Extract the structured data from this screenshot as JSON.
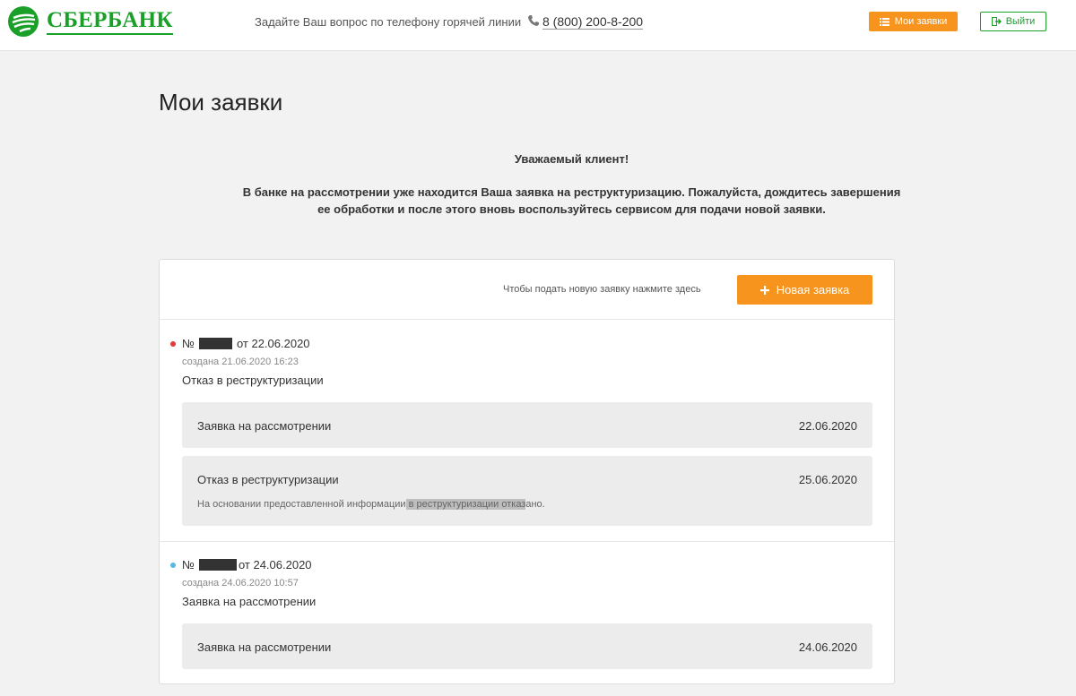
{
  "header": {
    "logo_text": "СБЕРБАНК",
    "hotline_text": "Задайте Ваш вопрос по телефону горячей линии",
    "phone": "8 (800) 200-8-200",
    "my_requests_label": "Мои заявки",
    "logout_label": "Выйти"
  },
  "page": {
    "title": "Мои заявки",
    "notice_heading": "Уважаемый клиент!",
    "notice_line1": "В банке на рассмотрении уже находится Ваша заявка на реструктуризацию. Пожалуйста, дождитесь завершения",
    "notice_line2": "ее обработки и после этого вновь воспользуйтесь сервисом для подачи новой заявки."
  },
  "card": {
    "new_hint": "Чтобы подать новую заявку нажмите здесь",
    "new_button": "Новая заявка"
  },
  "applications": [
    {
      "number_prefix": "№",
      "date_text": "от 22.06.2020",
      "created": "создана 21.06.2020 16:23",
      "status": "Отказ в реструктуризации",
      "dot_color": "#e53935",
      "stages": [
        {
          "name": "Заявка на рассмотрении",
          "date": "22.06.2020"
        },
        {
          "name": "Отказ в реструктуризации",
          "date": "25.06.2020",
          "note_part1": "На основании предоставленной информации",
          "note_highlight": " в реструктуризации отказ",
          "note_part2": "ано."
        }
      ]
    },
    {
      "number_prefix": "№",
      "date_text": "от 24.06.2020",
      "created": "создана 24.06.2020 10:57",
      "status": "Заявка на рассмотрении",
      "dot_color": "#5bb8e0",
      "stages": [
        {
          "name": "Заявка на рассмотрении",
          "date": "24.06.2020"
        }
      ]
    }
  ],
  "colors": {
    "brand_green": "#1a9f29",
    "accent_orange": "#f7941d"
  }
}
